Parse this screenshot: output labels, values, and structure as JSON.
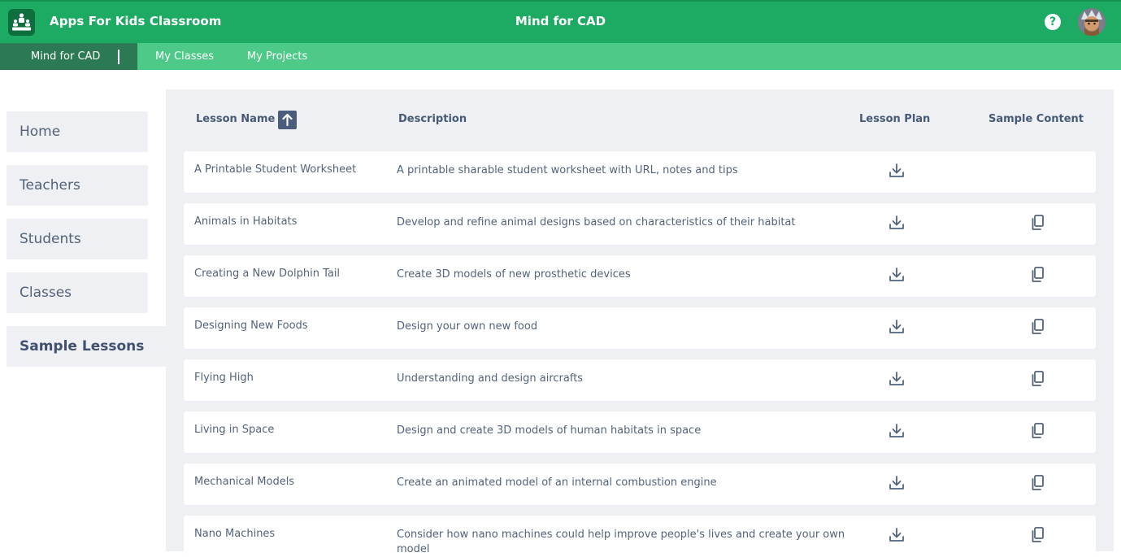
{
  "header": {
    "app_title": "Apps For Kids Classroom",
    "center_title": "Mind for CAD",
    "brand_color": "#1daa63",
    "help_glyph": "?",
    "logo_icon": "classroom-logo-icon",
    "avatar_icon": "user-avatar"
  },
  "subnav": {
    "items": [
      {
        "label": "Mind for CAD",
        "active": true
      },
      {
        "label": "My Classes",
        "active": false
      },
      {
        "label": "My Projects",
        "active": false
      }
    ]
  },
  "sidebar": {
    "items": [
      {
        "label": "Home",
        "active": false
      },
      {
        "label": "Teachers",
        "active": false
      },
      {
        "label": "Students",
        "active": false
      },
      {
        "label": "Classes",
        "active": false
      },
      {
        "label": "Sample Lessons",
        "active": true
      }
    ]
  },
  "table": {
    "columns": {
      "name": "Lesson Name",
      "description": "Description",
      "plan": "Lesson Plan",
      "sample": "Sample Content"
    },
    "sort_icon": "sort-ascending-icon",
    "rows": [
      {
        "name": "A Printable Student Worksheet",
        "description": "A printable sharable student worksheet with URL, notes and tips",
        "has_plan": true,
        "has_sample": false
      },
      {
        "name": "Animals in Habitats",
        "description": "Develop and refine animal designs based on characteristics of their habitat",
        "has_plan": true,
        "has_sample": true
      },
      {
        "name": "Creating a New Dolphin Tail",
        "description": "Create 3D models of new prosthetic devices",
        "has_plan": true,
        "has_sample": true
      },
      {
        "name": "Designing New Foods",
        "description": "Design your own new food",
        "has_plan": true,
        "has_sample": true
      },
      {
        "name": "Flying High",
        "description": "Understanding and design aircrafts",
        "has_plan": true,
        "has_sample": true
      },
      {
        "name": "Living in Space",
        "description": "Design and create 3D models of human habitats in space",
        "has_plan": true,
        "has_sample": true
      },
      {
        "name": "Mechanical Models",
        "description": "Create an animated model of an internal combustion engine",
        "has_plan": true,
        "has_sample": true
      },
      {
        "name": "Nano Machines",
        "description": "Consider how nano machines could help improve people's lives and create your own model",
        "has_plan": true,
        "has_sample": true
      }
    ]
  }
}
